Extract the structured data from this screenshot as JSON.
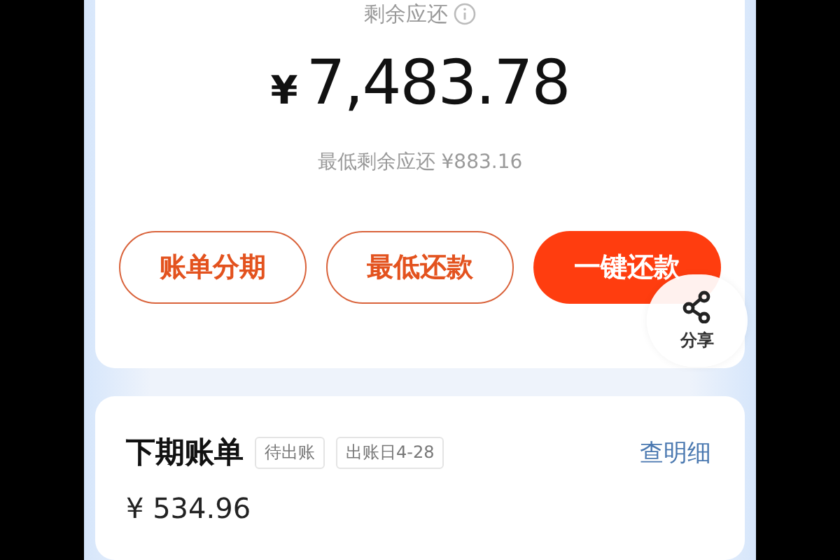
{
  "balance_card": {
    "label": "剩余应还",
    "amount": {
      "currency": "¥",
      "value": "7,483.78"
    },
    "minimum": "最低剩余应还 ¥883.16",
    "buttons": [
      {
        "label": "账单分期",
        "kind": "outline"
      },
      {
        "label": "最低还款",
        "kind": "outline"
      },
      {
        "label": "一键还款",
        "kind": "filled"
      }
    ]
  },
  "share": {
    "label": "分享"
  },
  "next_bill": {
    "title": "下期账单",
    "tags": [
      "待出账",
      "出账日4-28"
    ],
    "link": "查明细",
    "amount": "¥ 534.96"
  }
}
